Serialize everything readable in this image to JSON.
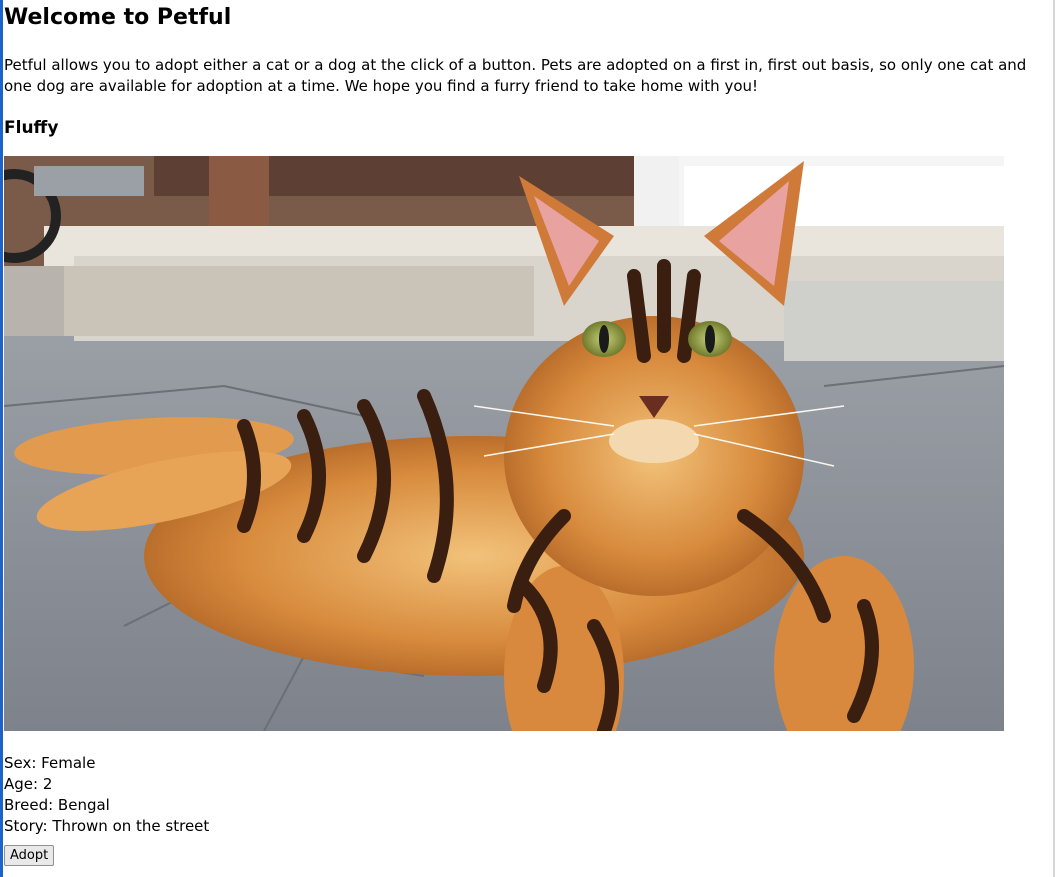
{
  "header": {
    "title": "Welcome to Petful",
    "intro": "Petful allows you to adopt either a cat or a dog at the click of a button. Pets are adopted on a first in, first out basis, so only one cat and one dog are available for adoption at a time. We hope you find a furry friend to take home with you!"
  },
  "pet": {
    "name": "Fluffy",
    "image_subject": "bengal-cat-lying-on-pavement",
    "sex": "Sex: Female",
    "age": "Age: 2",
    "breed": "Breed: Bengal",
    "story": "Story: Thrown on the street"
  },
  "actions": {
    "adopt_label": "Adopt"
  }
}
